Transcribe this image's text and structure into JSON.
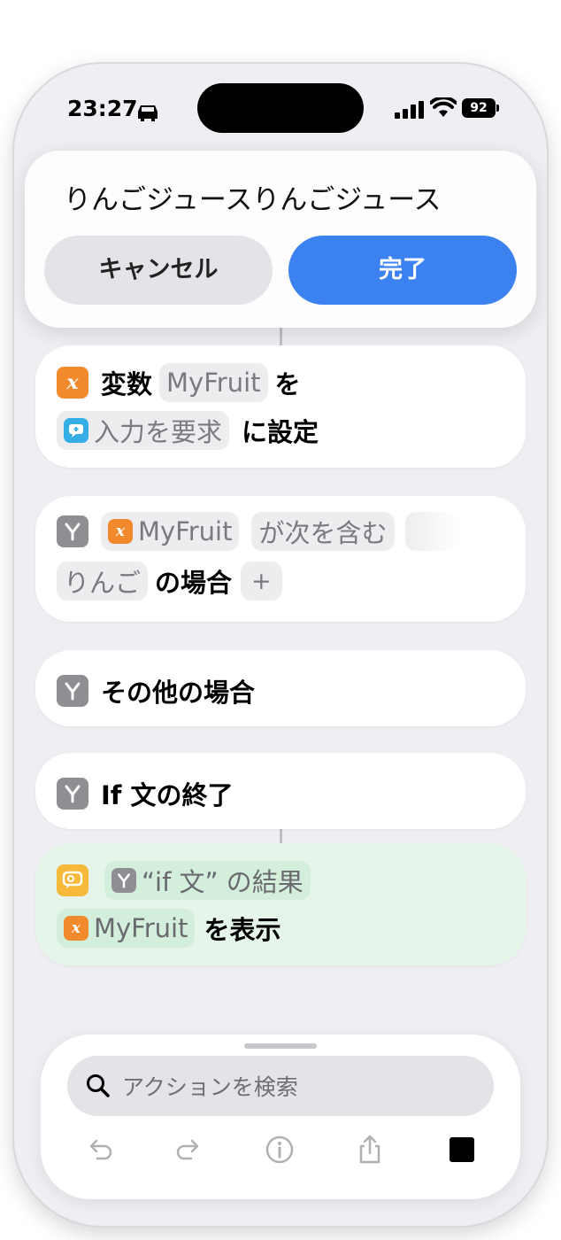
{
  "status_bar": {
    "time": "23:27",
    "battery": "92"
  },
  "popup": {
    "text_value": "りんごジュースりんごジュース",
    "cancel_label": "キャンセル",
    "done_label": "完了",
    "done_color": "#3b82f0"
  },
  "actions": {
    "set_variable": {
      "prefix": "変数",
      "variable_name": "MyFruit",
      "particle": "を",
      "input_token": "入力を要求",
      "suffix": "に設定"
    },
    "if": {
      "variable_token": "MyFruit",
      "condition": "が次を含む",
      "value": "りんご",
      "suffix": "の場合",
      "add": "+"
    },
    "otherwise": {
      "label": "その他の場合"
    },
    "end_if": {
      "label": "If 文の終了"
    },
    "show_result": {
      "if_result_token": "“if 文” の結果",
      "variable_token": "MyFruit",
      "suffix": "を表示"
    }
  },
  "bottom_panel": {
    "search_placeholder": "アクションを検索"
  },
  "icons": {
    "variable": "variable-icon",
    "ask_input": "ask-input-icon",
    "if": "branch-icon",
    "show_result": "show-result-icon",
    "search": "search-icon",
    "undo": "undo-icon",
    "redo": "redo-icon",
    "info": "info-icon",
    "share": "share-icon",
    "stop": "stop-icon"
  }
}
